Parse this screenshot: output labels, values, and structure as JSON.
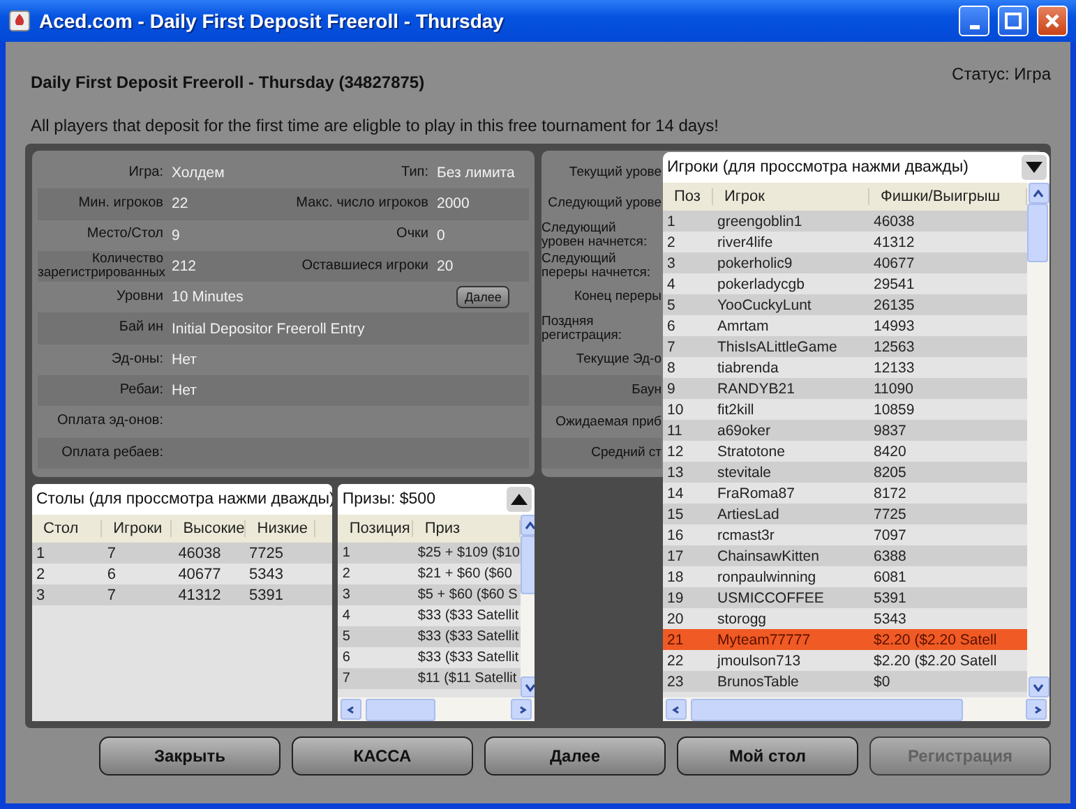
{
  "window": {
    "title": "Aced.com - Daily First Deposit Freeroll - Thursday"
  },
  "header": {
    "title": "Daily First Deposit Freeroll - Thursday (34827875)",
    "status": "Статус: Игра",
    "description": "All players that deposit for the first time are eligble to play in this free tournament for 14 days!"
  },
  "info": [
    {
      "label": "Игра:",
      "value": "Холдем",
      "label_2": "Тип:",
      "value_2": "Без лимита"
    },
    {
      "label": "Мин. игроков",
      "value": "22",
      "label_2": "Макс. число игроков",
      "value_2": "2000"
    },
    {
      "label": "Место/Стол",
      "value": "9",
      "label_2": "Очки",
      "value_2": "0"
    },
    {
      "label": "Количество зарегистрированных",
      "value": "212",
      "label_2": "Оставшиеся игроки",
      "value_2": "20"
    },
    {
      "label": "Уровни",
      "value": "10 Minutes",
      "button": "Далее"
    },
    {
      "label": "Бай ин",
      "value": "Initial Depositor Freeroll Entry"
    },
    {
      "label": "Эд-оны:",
      "value": "Нет"
    },
    {
      "label": "Ребаи:",
      "value": "Нет"
    },
    {
      "label": "Оплата эд-онов:"
    },
    {
      "label": "Оплата ребаев:"
    }
  ],
  "info_right": [
    "Текущий урове",
    "Следующий урове",
    "Следующий уровен начнется:",
    "Следующий переры начнется:",
    "Конец переры",
    "Поздняя регистрация:",
    "Текущие Эд-о",
    "Баун",
    "Ожидаемая приб",
    "Средний ст"
  ],
  "tables": {
    "title": "Столы (для проссмотра нажми дважды)",
    "columns": [
      "Стол",
      "Игроки",
      "Высокие",
      "Низкие"
    ],
    "rows": [
      [
        "1",
        "7",
        "46038",
        "7725"
      ],
      [
        "2",
        "6",
        "40677",
        "5343"
      ],
      [
        "3",
        "7",
        "41312",
        "5391"
      ]
    ]
  },
  "prizes": {
    "title": "Призы: $500",
    "columns": [
      "Позиция",
      "Приз"
    ],
    "rows": [
      [
        "1",
        "$25 + $109 ($10"
      ],
      [
        "2",
        "$21 + $60 ($60"
      ],
      [
        "3",
        "$5 + $60 ($60 S"
      ],
      [
        "4",
        "$33 ($33 Satellit"
      ],
      [
        "5",
        "$33 ($33 Satellit"
      ],
      [
        "6",
        "$33 ($33 Satellit"
      ],
      [
        "7",
        "$11 ($11 Satellit"
      ]
    ]
  },
  "players": {
    "title": "Игроки (для проссмотра нажми дважды)",
    "columns": [
      "Поз",
      "Игрок",
      "Фишки/Выигрыш"
    ],
    "rows": [
      {
        "cells": [
          "1",
          "greengoblin1",
          "46038"
        ],
        "selected": false
      },
      {
        "cells": [
          "2",
          "river4life",
          "41312"
        ],
        "selected": false
      },
      {
        "cells": [
          "3",
          "pokerholic9",
          "40677"
        ],
        "selected": false
      },
      {
        "cells": [
          "4",
          "pokerladycgb",
          "29541"
        ],
        "selected": false
      },
      {
        "cells": [
          "5",
          "YooCuckyLunt",
          "26135"
        ],
        "selected": false
      },
      {
        "cells": [
          "6",
          "Amrtam",
          "14993"
        ],
        "selected": false
      },
      {
        "cells": [
          "7",
          "ThisIsALittleGame",
          "12563"
        ],
        "selected": false
      },
      {
        "cells": [
          "8",
          "tiabrenda",
          "12133"
        ],
        "selected": false
      },
      {
        "cells": [
          "9",
          "RANDYB21",
          "11090"
        ],
        "selected": false
      },
      {
        "cells": [
          "10",
          "fit2kill",
          "10859"
        ],
        "selected": false
      },
      {
        "cells": [
          "11",
          "a69oker",
          "9837"
        ],
        "selected": false
      },
      {
        "cells": [
          "12",
          "Stratotone",
          "8420"
        ],
        "selected": false
      },
      {
        "cells": [
          "13",
          "stevitale",
          "8205"
        ],
        "selected": false
      },
      {
        "cells": [
          "14",
          "FraRoma87",
          "8172"
        ],
        "selected": false
      },
      {
        "cells": [
          "15",
          "ArtiesLad",
          "7725"
        ],
        "selected": false
      },
      {
        "cells": [
          "16",
          "rcmast3r",
          "7097"
        ],
        "selected": false
      },
      {
        "cells": [
          "17",
          "ChainsawKitten",
          "6388"
        ],
        "selected": false
      },
      {
        "cells": [
          "18",
          "ronpaulwinning",
          "6081"
        ],
        "selected": false
      },
      {
        "cells": [
          "19",
          "USMICCOFFEE",
          "5391"
        ],
        "selected": false
      },
      {
        "cells": [
          "20",
          "storogg",
          "5343"
        ],
        "selected": false
      },
      {
        "cells": [
          "21",
          "Myteam77777",
          "$2.20 ($2.20 Satell"
        ],
        "selected": true
      },
      {
        "cells": [
          "22",
          "jmoulson713",
          "$2.20 ($2.20 Satell"
        ],
        "selected": false
      },
      {
        "cells": [
          "23",
          "BrunosTable",
          "$0"
        ],
        "selected": false
      }
    ]
  },
  "buttons": [
    {
      "label": "Закрыть",
      "disabled": false
    },
    {
      "label": "КАССА",
      "disabled": false
    },
    {
      "label": "Далее",
      "disabled": false
    },
    {
      "label": "Мой стол",
      "disabled": false
    },
    {
      "label": "Регистрация",
      "disabled": true
    }
  ]
}
